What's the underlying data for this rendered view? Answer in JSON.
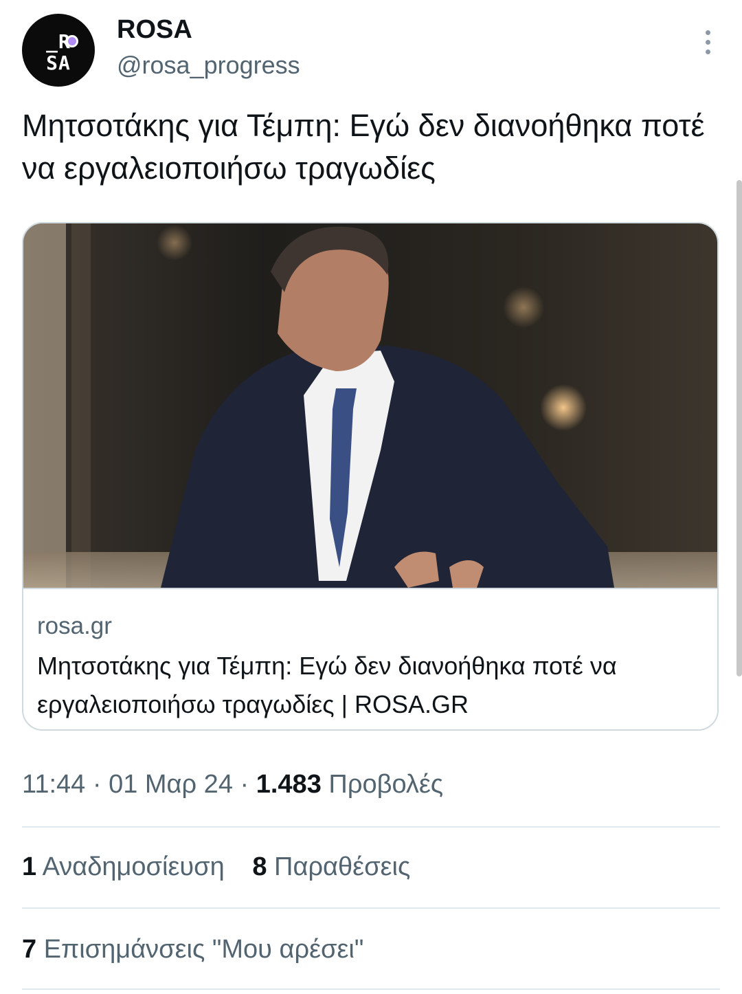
{
  "author": {
    "display_name": "ROSA",
    "handle": "@rosa_progress",
    "avatar_text": [
      "_R",
      "SA"
    ]
  },
  "tweet": {
    "text": "Μητσοτάκης για Τέμπη: Εγώ δεν διανοήθηκα ποτέ να εργαλειοποιήσω τραγωδίες"
  },
  "link_card": {
    "domain": "rosa.gr",
    "title": "Μητσοτάκης για Τέμπη: Εγώ δεν διανοήθηκα ποτέ να εργαλειοποιήσω τραγωδίες | ROSA.GR",
    "image_alt": "Man in dark suit and blue tie speaking on stage"
  },
  "meta": {
    "time": "11:44",
    "sep1": "·",
    "date": "01 Μαρ 24",
    "sep2": "·",
    "views_count": "1.483",
    "views_label": "Προβολές"
  },
  "stats": {
    "reposts_count": "1",
    "reposts_label": "Αναδημοσίευση",
    "quotes_count": "8",
    "quotes_label": "Παραθέσεις",
    "likes_count": "7",
    "likes_label": "Επισημάνσεις \"Μου αρέσει\""
  },
  "colors": {
    "text_primary": "#0f1419",
    "text_secondary": "#536471",
    "border": "#cfd9de",
    "avatar_bg": "#0b0b0b",
    "avatar_accent": "#b18cf2"
  },
  "icons": {
    "more": "more-vertical-icon"
  }
}
